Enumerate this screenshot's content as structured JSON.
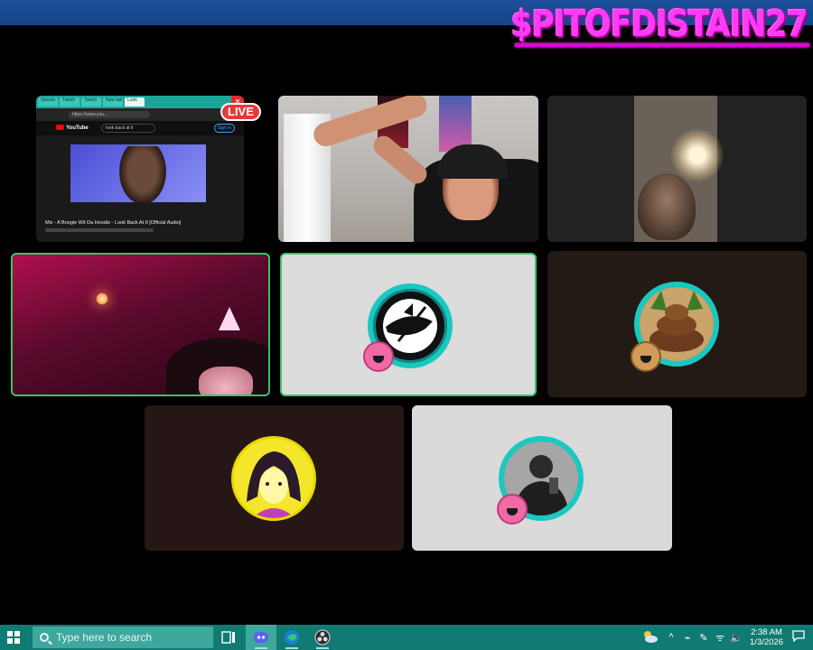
{
  "window": {
    "streamer_name": "$PITOFDISTAIN27",
    "controls": [
      "—",
      "☐",
      "✕"
    ]
  },
  "screen_share": {
    "live_label": "LIVE",
    "tabs": [
      "Stream",
      "Twitch",
      "Twitch",
      "New tab",
      "Look"
    ],
    "url": "https://www.you...",
    "youtube_label": "YouTube",
    "search_text": "look back at it",
    "sign_in": "Sign in",
    "video_title": "Mix - A Boogie Wit Da Hoodie - Look Back At It [Official Audio]"
  },
  "taskbar": {
    "search_placeholder": "Type here to search",
    "apps": [
      "task-view",
      "discord",
      "edge",
      "obs"
    ],
    "tray_symbols": [
      "^",
      "⌁",
      "✎",
      "ᯤ",
      "🔈"
    ],
    "time": "2:38 AM",
    "date": "1/3/2026",
    "weather_icon": "partly-cloudy-night",
    "notification_icon": "chat-bubble"
  },
  "colors": {
    "streamer_name": "#ff3bf5",
    "taskbar": "#117a72",
    "active_speaker_border": "#37c46d",
    "live_badge": "#e8383b",
    "avatar_ring": "#19c9c0"
  }
}
